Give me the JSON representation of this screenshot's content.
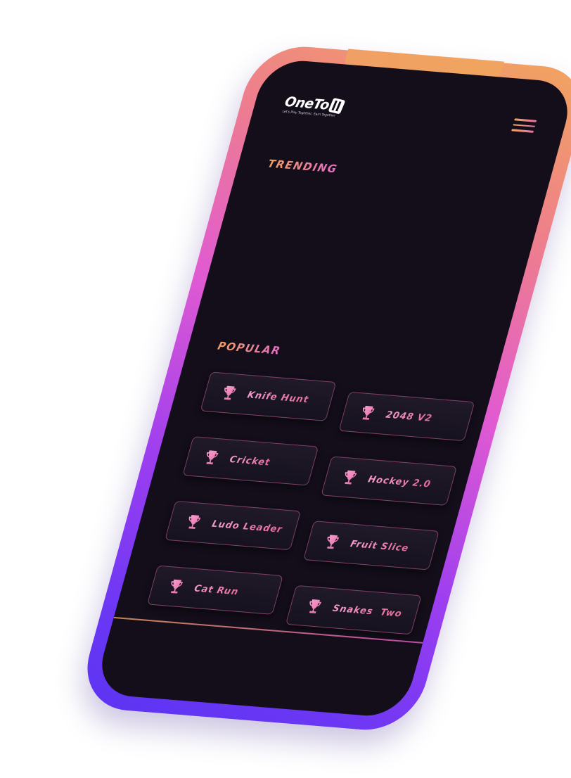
{
  "app": {
    "logo_text": "OneTo",
    "logo_mark": "11",
    "tagline": "Let's Play Together, Earn Together"
  },
  "header": {
    "menu_icon": "hamburger-menu-icon"
  },
  "sections": {
    "trending": "TRENDING",
    "popular": "POPULAR"
  },
  "games": [
    {
      "label": "Knife Hunt",
      "icon": "trophy-icon"
    },
    {
      "label": "2048 V2",
      "icon": "trophy-icon"
    },
    {
      "label": "Cricket",
      "icon": "trophy-icon"
    },
    {
      "label": "Hockey 2.0",
      "icon": "trophy-icon"
    },
    {
      "label": "Ludo Leader",
      "icon": "trophy-icon"
    },
    {
      "label": "Fruit Slice",
      "icon": "trophy-icon"
    },
    {
      "label": "Cat Run",
      "icon": "trophy-icon"
    },
    {
      "label": "Snakes  Two",
      "icon": "trophy-icon"
    }
  ],
  "colors": {
    "frame_top": "#f2a55e",
    "frame_mid": "#e15ad2",
    "frame_bottom": "#5b34f2",
    "screen_bg": "#130e1a",
    "accent_text": "#ee80b4"
  }
}
